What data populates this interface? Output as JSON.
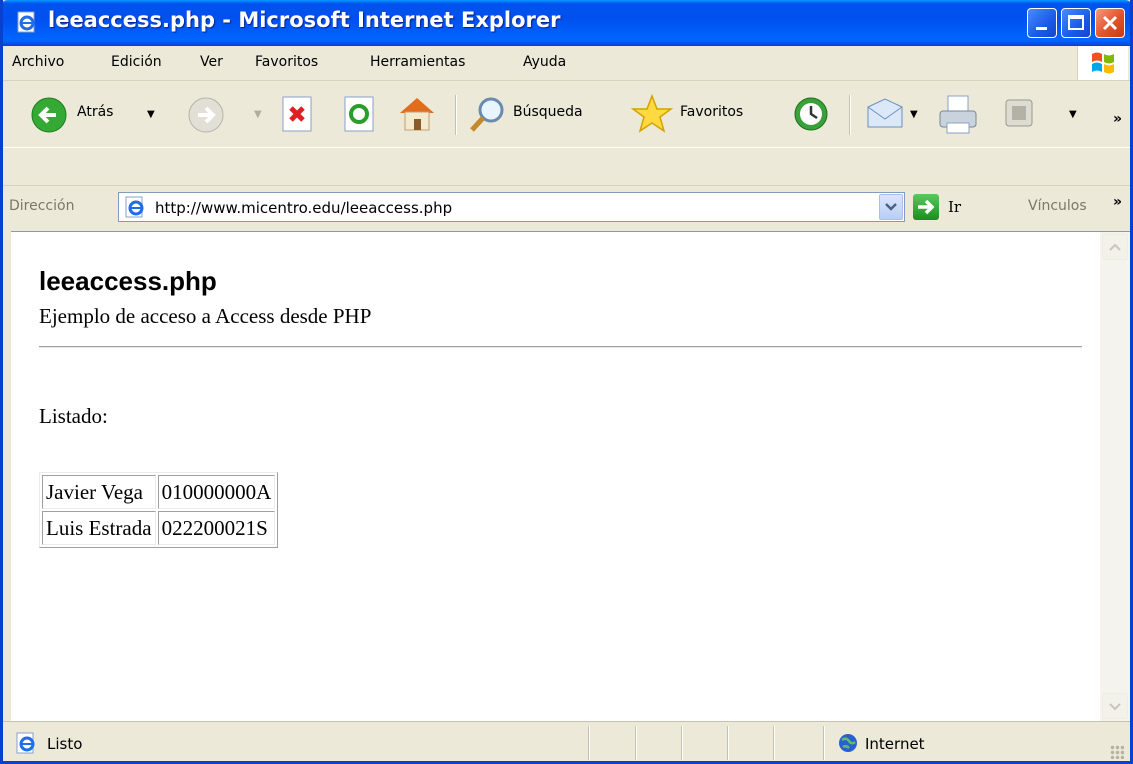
{
  "window": {
    "title": "leeaccess.php - Microsoft Internet Explorer"
  },
  "menu": {
    "items": [
      "Archivo",
      "Edición",
      "Ver",
      "Favoritos",
      "Herramientas",
      "Ayuda"
    ]
  },
  "toolbar": {
    "back_label": "Atrás",
    "search_label": "Búsqueda",
    "favorites_label": "Favoritos"
  },
  "address": {
    "label": "Dirección",
    "url": "http://www.micentro.edu/leeaccess.php",
    "go_label": "Ir",
    "links_label": "Vínculos"
  },
  "page": {
    "title": "leeaccess.php",
    "subtitle": "Ejemplo de acceso a Access desde PHP",
    "listing_label": "Listado:",
    "rows": [
      {
        "name": "Javier Vega",
        "code": "010000000A"
      },
      {
        "name": "Luis Estrada",
        "code": "022200021S"
      }
    ]
  },
  "status": {
    "text": "Listo",
    "zone": "Internet"
  },
  "colors": {
    "titlebar": "#0050ee",
    "chrome": "#ece9d8",
    "go_button": "#1c8e1c"
  }
}
